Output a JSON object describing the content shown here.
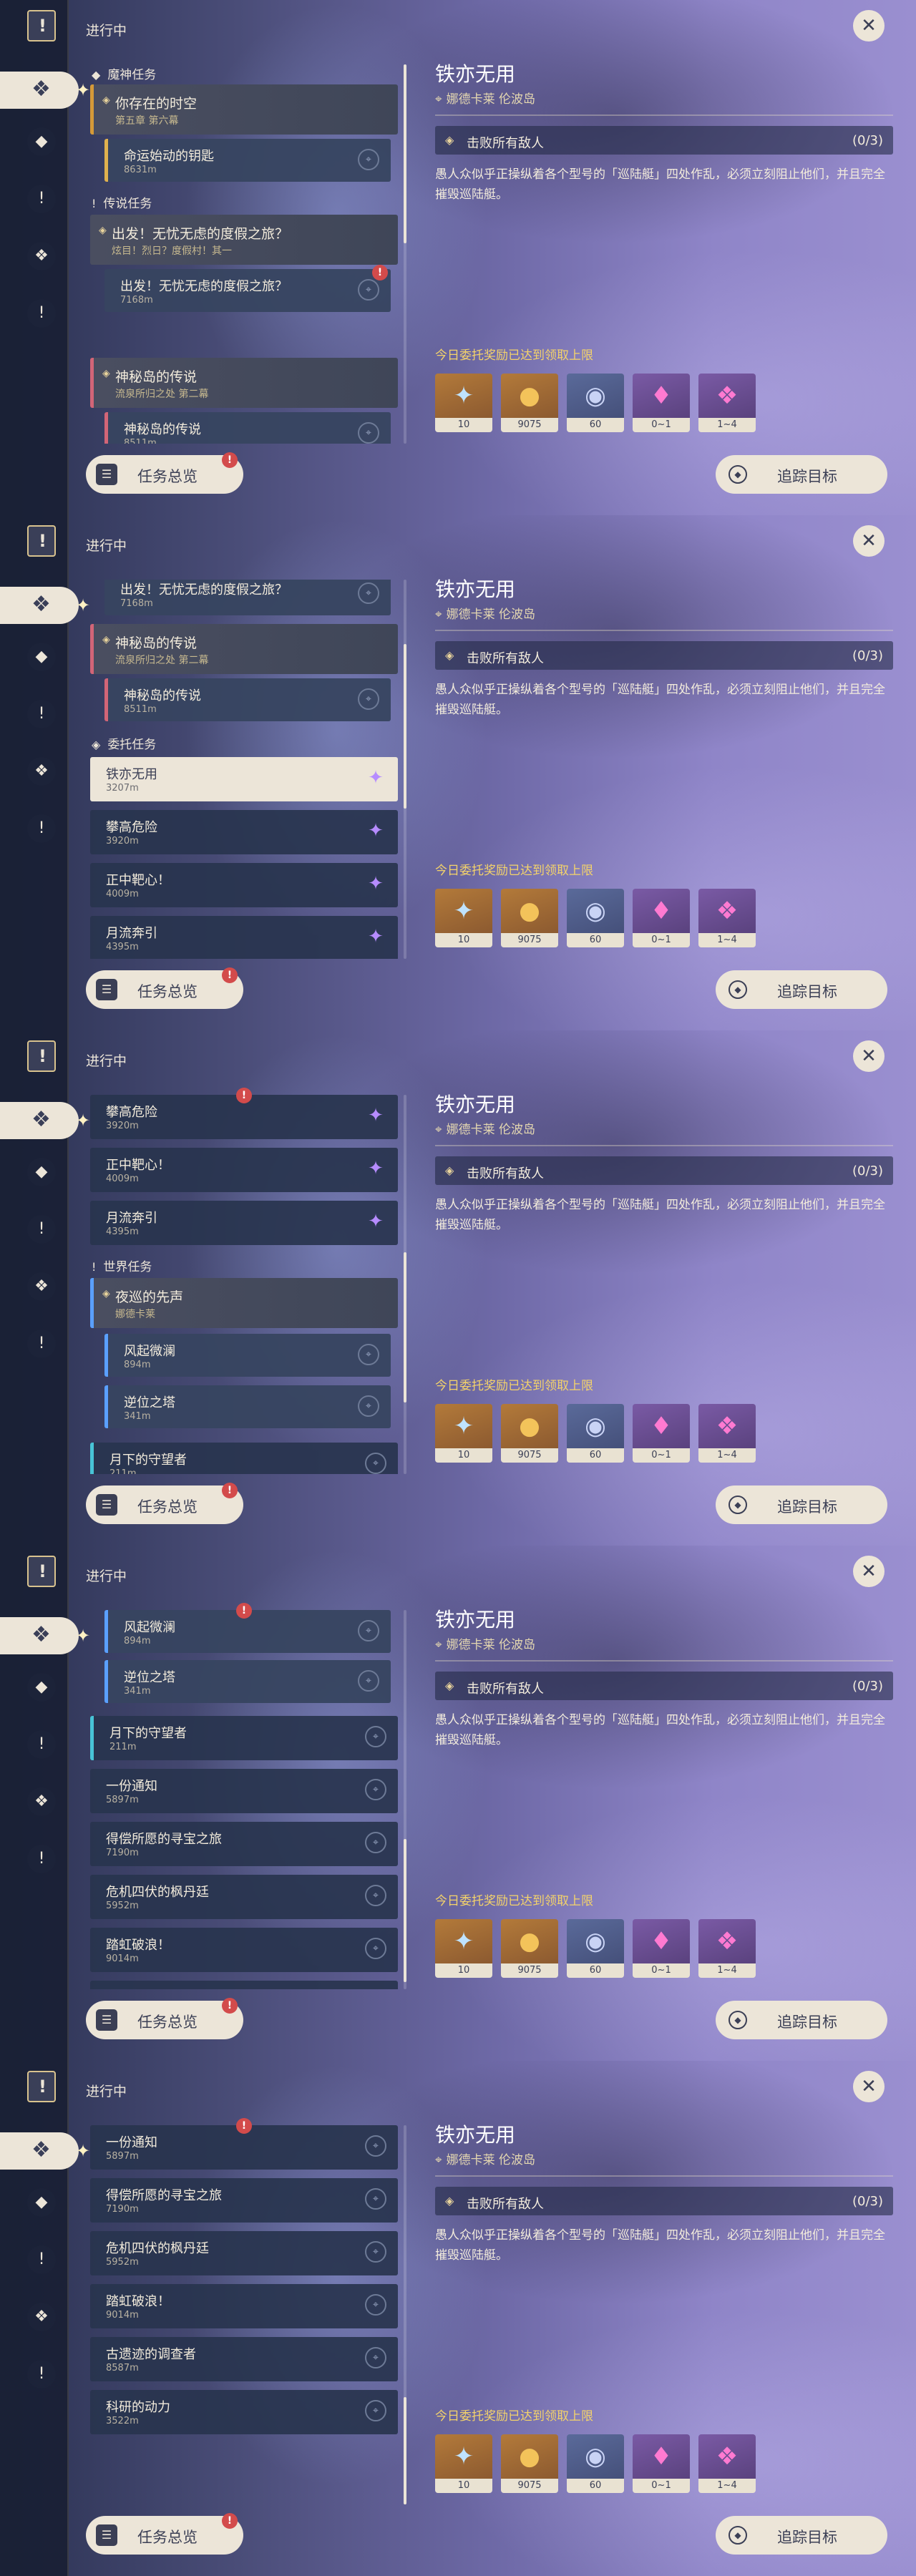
{
  "status": "进行中",
  "overview_button": "任务总览",
  "track_button": "追踪目标",
  "close_symbol": "✕",
  "alert_symbol": "!",
  "quest_detail": {
    "title": "铁亦无用",
    "location": "娜德卡莱 伦波岛",
    "objective": "击败所有敌人",
    "progress": "(0/3)",
    "description": "愚人众似乎正操纵着各个型号的「巡陆艇」四处作乱，必须立刻阻止他们，并且完全摧毁巡陆艇。",
    "reward_notice": "今日委托奖励已达到领取上限",
    "rewards": [
      {
        "count": "10",
        "icon": "star-glint",
        "bg": "orange"
      },
      {
        "count": "9075",
        "icon": "mora-coin",
        "bg": "orange"
      },
      {
        "count": "60",
        "icon": "eye",
        "bg": "blue"
      },
      {
        "count": "0~1",
        "icon": "crystal",
        "bg": "purple"
      },
      {
        "count": "1~4",
        "icon": "crystals",
        "bg": "purple"
      }
    ]
  },
  "sections": {
    "archon": "魔神任务",
    "story": "传说任务",
    "commission": "委托任务",
    "world": "世界任务"
  },
  "quests": {
    "q1": {
      "title": "你存在的时空",
      "subtitle": "第五章 第六幕"
    },
    "q1a": {
      "title": "命运始动的钥匙",
      "dist": "8631m"
    },
    "q2": {
      "title": "出发！无忧无虑的度假之旅？",
      "subtitle": "炫目！烈日？度假村！其一"
    },
    "q2a": {
      "title": "出发！无忧无虑的度假之旅？",
      "dist": "7168m"
    },
    "q3": {
      "title": "神秘岛的传说",
      "subtitle": "流泉所归之处 第二幕"
    },
    "q3a": {
      "title": "神秘岛的传说",
      "dist": "8511m"
    },
    "c1": {
      "title": "铁亦无用",
      "dist": "3207m"
    },
    "c2": {
      "title": "攀高危险",
      "dist": "3920m"
    },
    "c3": {
      "title": "正中靶心！",
      "dist": "4009m"
    },
    "c4": {
      "title": "月流奔引",
      "dist": "4395m"
    },
    "w1": {
      "title": "夜巡的先声",
      "subtitle": "娜德卡莱"
    },
    "w1a": {
      "title": "风起微澜",
      "dist": "894m"
    },
    "w1b": {
      "title": "逆位之塔",
      "dist": "341m"
    },
    "w2": {
      "title": "月下的守望者",
      "dist": "211m"
    },
    "w3": {
      "title": "一份通知",
      "dist": "5897m"
    },
    "w4": {
      "title": "得偿所愿的寻宝之旅",
      "dist": "7190m"
    },
    "w5": {
      "title": "危机四伏的枫丹廷",
      "dist": "5952m"
    },
    "w6": {
      "title": "踏虹破浪！",
      "dist": "9014m"
    },
    "w7": {
      "title": "古遗迹的调查者",
      "dist": "8587m"
    },
    "w8": {
      "title": "科研的动力",
      "dist": "3522m"
    }
  }
}
